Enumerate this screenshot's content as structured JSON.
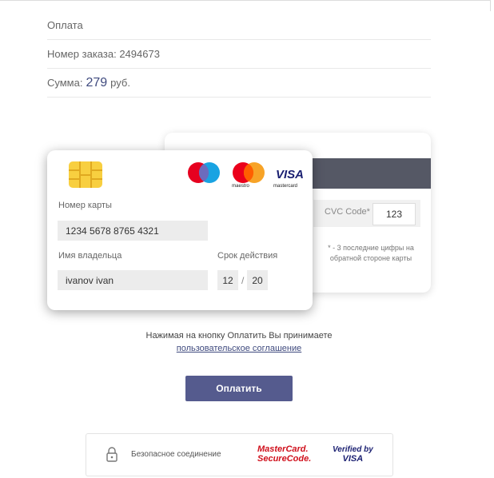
{
  "header": {
    "title": "Оплата"
  },
  "order": {
    "label": "Номер заказа:",
    "number": "2494673"
  },
  "sum": {
    "label": "Сумма:",
    "value": "279",
    "currency": "руб."
  },
  "card_front": {
    "brands": [
      "maestro",
      "mastercard",
      "VISA"
    ],
    "card_number_label": "Номер карты",
    "card_number_value": "1234 5678 8765 4321",
    "holder_label": "Имя владельца",
    "holder_value": "ivanov ivan",
    "expiry_label": "Срок действия",
    "expiry_month": "12",
    "expiry_separator": "/",
    "expiry_year": "20"
  },
  "card_back": {
    "cvc_label": "CVC Code*",
    "cvc_value": "123",
    "cvc_hint": "* - 3 последние цифры на обратной стороне карты"
  },
  "agreement": {
    "text": "Нажимая на кнопку Оплатить Вы принимаете",
    "link": "пользовательское соглашение"
  },
  "pay_button": {
    "label": "Оплатить"
  },
  "secure": {
    "label": "Безопасное соединение",
    "mastercard_line1": "MasterCard.",
    "mastercard_line2": "SecureCode.",
    "visa_line1": "Verified by",
    "visa_line2": "VISA"
  },
  "colors": {
    "accent": "#555b8e",
    "chip": "#f8cf40",
    "stripe": "#555865"
  }
}
